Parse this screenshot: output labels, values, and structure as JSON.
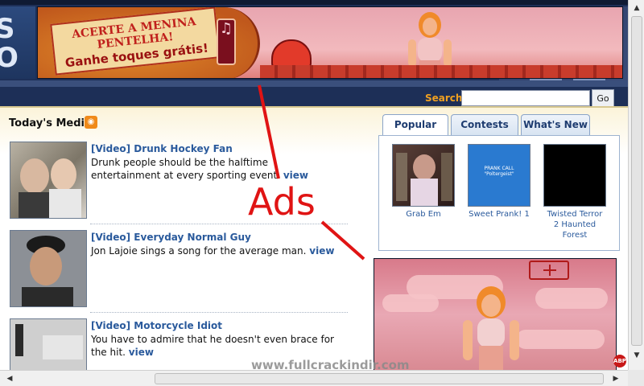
{
  "header": {
    "logo_text": "S\nO"
  },
  "banner_ad": {
    "sign_line1": "ACERTE A MENINA",
    "sign_line2": "PENTELHA!",
    "sign_line3": "Ganhe toques grátis!",
    "phone_glyph": "♫"
  },
  "search": {
    "label": "Search:",
    "placeholder": "",
    "value": "",
    "button": "Go"
  },
  "todays_media": {
    "title": "Today's Media",
    "rss_glyph": "◉",
    "items": [
      {
        "title": "[Video] Drunk Hockey Fan",
        "desc": "Drunk people should be the halftime entertainment at every sporting event. ",
        "view": "view"
      },
      {
        "title": "[Video] Everyday Normal Guy",
        "desc": "Jon Lajoie sings a song for the average man. ",
        "view": "view"
      },
      {
        "title": "[Video] Motorcycle Idiot",
        "desc": "You have to admire that he doesn't even brace for the hit. ",
        "view": "view"
      }
    ]
  },
  "tabs": [
    {
      "label": "Popular",
      "active": true
    },
    {
      "label": "Contests",
      "active": false
    },
    {
      "label": "What's New",
      "active": false
    }
  ],
  "popular": [
    {
      "caption": "Grab Em",
      "thumb_text": ""
    },
    {
      "caption": "Sweet Prank! 1",
      "thumb_text": "PRANK CALL\n\"Poltergeist\""
    },
    {
      "caption": "Twisted Terror 2 Haunted Forest",
      "thumb_text": ""
    }
  ],
  "annotation": {
    "label": "Ads",
    "color": "#e01414"
  },
  "watermark": "www.fullcrackindir.com",
  "scroll": {
    "up": "▲",
    "down": "▼",
    "left": "◀",
    "right": "▶"
  },
  "abp": "ABP"
}
